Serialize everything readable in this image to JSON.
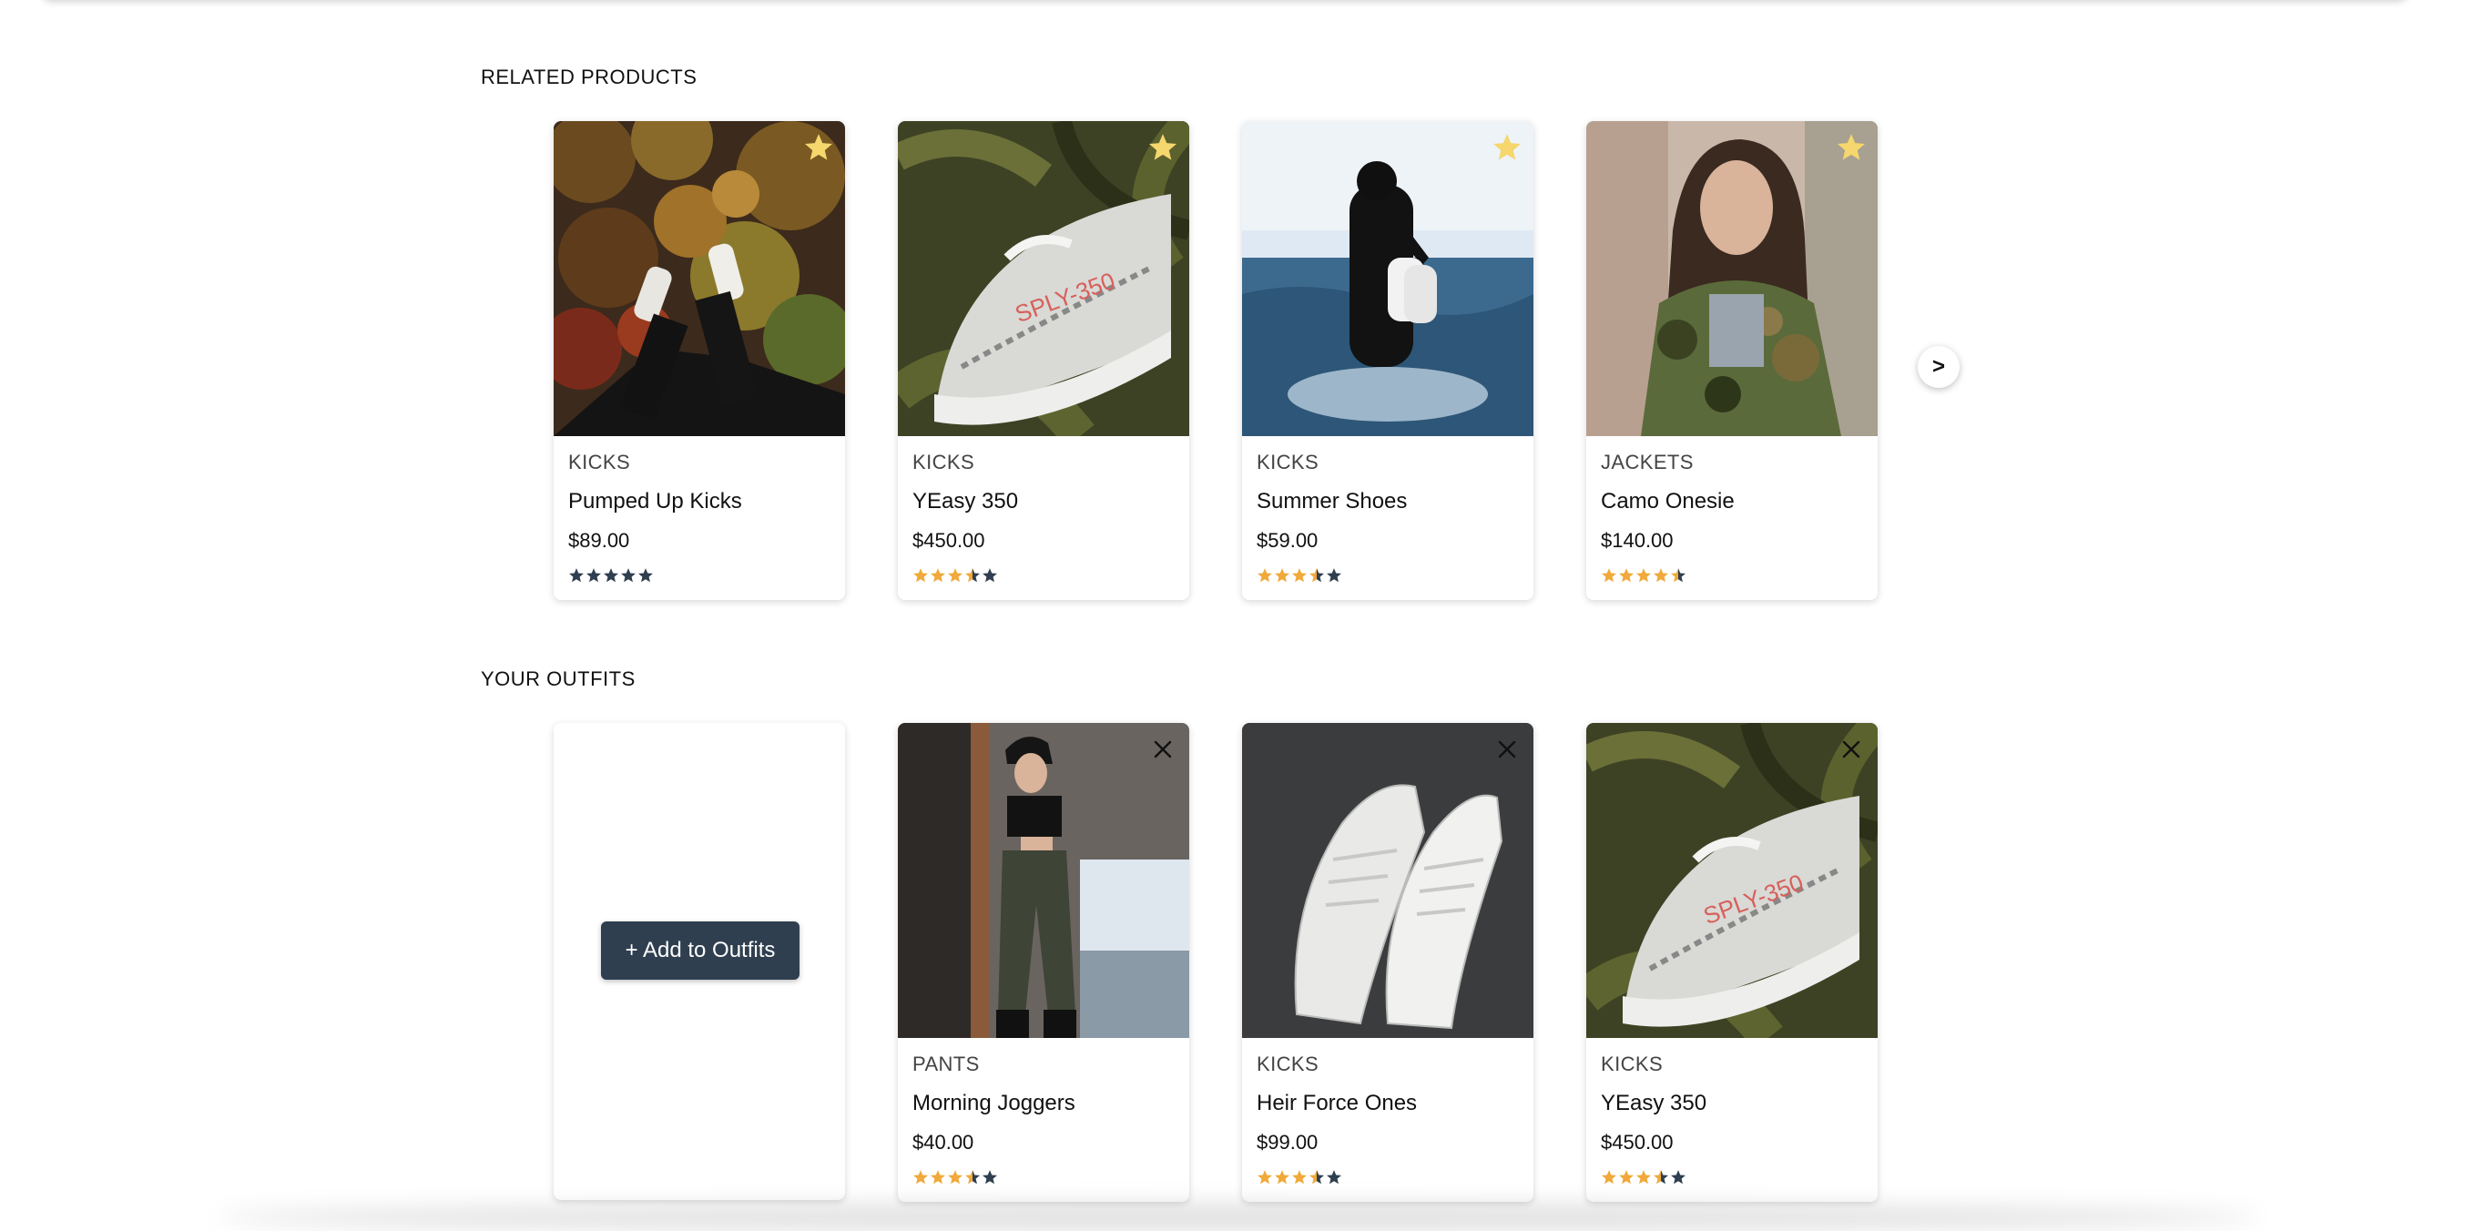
{
  "related": {
    "title": "RELATED PRODUCTS",
    "next_label": ">",
    "items": [
      {
        "category": "KICKS",
        "name": "Pumped Up Kicks",
        "price": "$89.00",
        "rating": 0,
        "image": "sneakers-on-autumn-cliff"
      },
      {
        "category": "KICKS",
        "name": "YEasy 350",
        "price": "$450.00",
        "rating": 3.5,
        "image": "yeezy-on-ferns"
      },
      {
        "category": "KICKS",
        "name": "Summer Shoes",
        "price": "$59.00",
        "rating": 3.5,
        "image": "person-in-water-holding-shoes"
      },
      {
        "category": "JACKETS",
        "name": "Camo Onesie",
        "price": "$140.00",
        "rating": 4.5,
        "image": "woman-in-camo-jacket"
      }
    ]
  },
  "outfits": {
    "title": "YOUR OUTFITS",
    "add_label": "+ Add to Outfits",
    "items": [
      {
        "category": "PANTS",
        "name": "Morning Joggers",
        "price": "$40.00",
        "rating": 3.5,
        "image": "woman-in-joggers"
      },
      {
        "category": "KICKS",
        "name": "Heir Force Ones",
        "price": "$99.00",
        "rating": 3.5,
        "image": "white-sneakers-dark-bg"
      },
      {
        "category": "KICKS",
        "name": "YEasy 350",
        "price": "$450.00",
        "rating": 3.5,
        "image": "yeezy-on-ferns"
      }
    ]
  },
  "colors": {
    "star_filled": "#f0a93a",
    "star_empty": "#2f3f4f",
    "favorite": "#f5d76e",
    "button_bg": "#2f3f4f"
  }
}
